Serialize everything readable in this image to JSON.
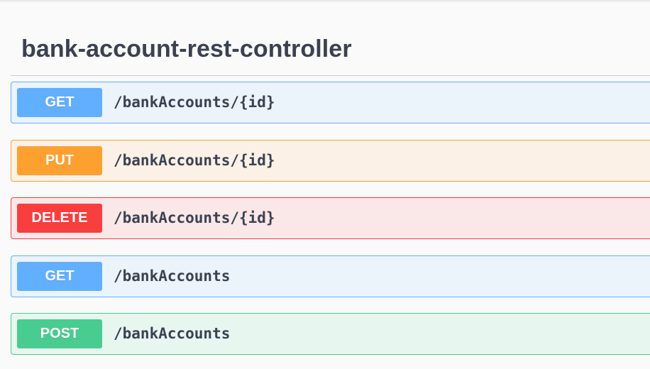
{
  "tag": {
    "title": "bank-account-rest-controller"
  },
  "colors": {
    "get": "#61affe",
    "put": "#fca130",
    "delete": "#f93e3e",
    "post": "#49cc90",
    "text": "#3b4151"
  },
  "operations": [
    {
      "method": "GET",
      "path": "/bankAccounts/{id}"
    },
    {
      "method": "PUT",
      "path": "/bankAccounts/{id}"
    },
    {
      "method": "DELETE",
      "path": "/bankAccounts/{id}"
    },
    {
      "method": "GET",
      "path": "/bankAccounts"
    },
    {
      "method": "POST",
      "path": "/bankAccounts"
    }
  ]
}
